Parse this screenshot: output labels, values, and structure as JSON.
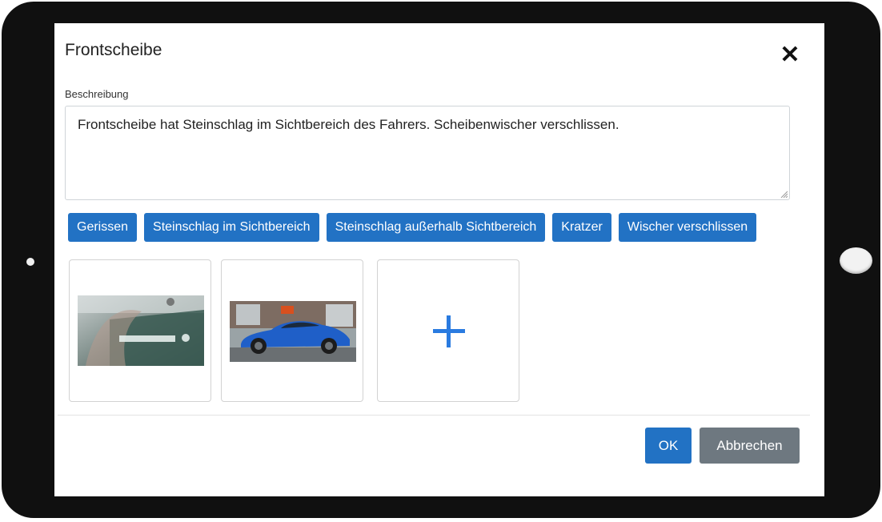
{
  "dialog": {
    "title": "Frontscheibe",
    "close_icon": "close-icon",
    "description_label": "Beschreibung",
    "description_value": "Frontscheibe hat Steinschlag im Sichtbereich des Fahrers. Scheibenwischer verschlissen."
  },
  "tags": [
    "Gerissen",
    "Steinschlag im Sichtbereich",
    "Steinschlag außerhalb Sichtbereich",
    "Kratzer",
    "Wischer verschlissen"
  ],
  "photos": {
    "items": [
      "windshield-damage-photo",
      "blue-car-photo"
    ],
    "add_icon": "plus-icon"
  },
  "footer": {
    "ok_label": "OK",
    "cancel_label": "Abbrechen"
  },
  "colors": {
    "primary": "#2272c4",
    "secondary": "#6e7880",
    "add_plus": "#2a7be0"
  }
}
